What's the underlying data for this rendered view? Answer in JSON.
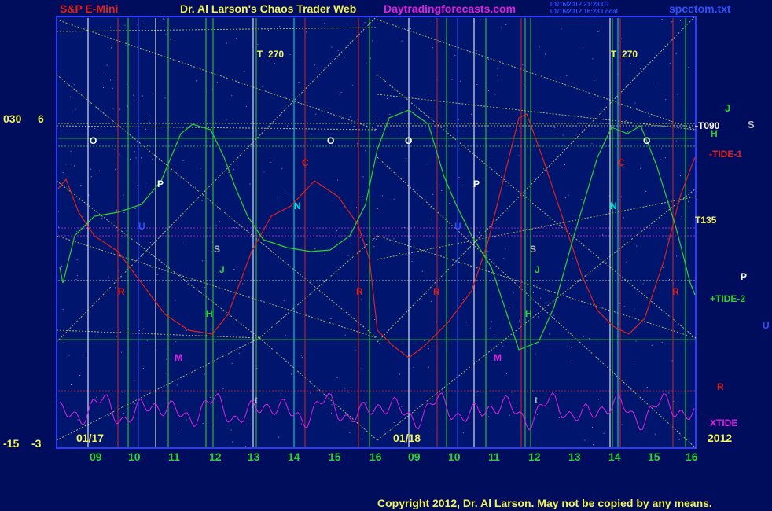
{
  "header": {
    "symbol": "S&P E-Mini",
    "title": "Dr. Al Larson's Chaos Trader Web",
    "site": "Daytradingforecasts.com",
    "timestamp_1": "01/16/2012 21:28 UT",
    "timestamp_2": "01/16/2012 16:28 Local",
    "filename": "spcctom.txt"
  },
  "footer": {
    "copyright": "Copyright 2012, Dr. Al Larson. May not be copied by any means.",
    "year": "2012"
  },
  "colors": {
    "background": "#000d5c",
    "plot_background": "#00166e",
    "tide1": "#e0201c",
    "tide2": "#2ed12e",
    "xtide": "#e020e0",
    "grid": "#e8e85a",
    "axis_hours": "#2ed12e"
  },
  "chart_data": {
    "type": "line",
    "title": "S&P E-Mini",
    "y_left_outer": {
      "top": "030",
      "bottom": "-15"
    },
    "y_left_inner": {
      "top": "6",
      "bottom": "-3"
    },
    "dates": [
      "01/17",
      "01/18"
    ],
    "x_hours": [
      "09",
      "10",
      "11",
      "12",
      "13",
      "14",
      "15",
      "16",
      "09",
      "10",
      "11",
      "12",
      "13",
      "14",
      "15",
      "16"
    ],
    "series": [
      {
        "name": "-TIDE-1",
        "color": "#e0201c"
      },
      {
        "name": "+TIDE-2",
        "color": "#2ed12e"
      },
      {
        "name": "XTIDE",
        "color": "#e020e0"
      }
    ],
    "right_labels": [
      "J",
      "S",
      "-T090",
      "H",
      "-TIDE-1",
      "T135",
      "P",
      "+TIDE-2",
      "U",
      "R",
      "XTIDE"
    ],
    "top_markers": [
      {
        "letter": "T",
        "value": "270"
      },
      {
        "letter": "T",
        "value": "270"
      }
    ],
    "planet_markers": [
      "O",
      "O",
      "O",
      "O",
      "P",
      "P",
      "U",
      "U",
      "C",
      "C",
      "N",
      "N",
      "S",
      "S",
      "J",
      "J",
      "H",
      "H",
      "R",
      "R",
      "R",
      "R",
      "M",
      "M",
      "t",
      "t"
    ]
  }
}
